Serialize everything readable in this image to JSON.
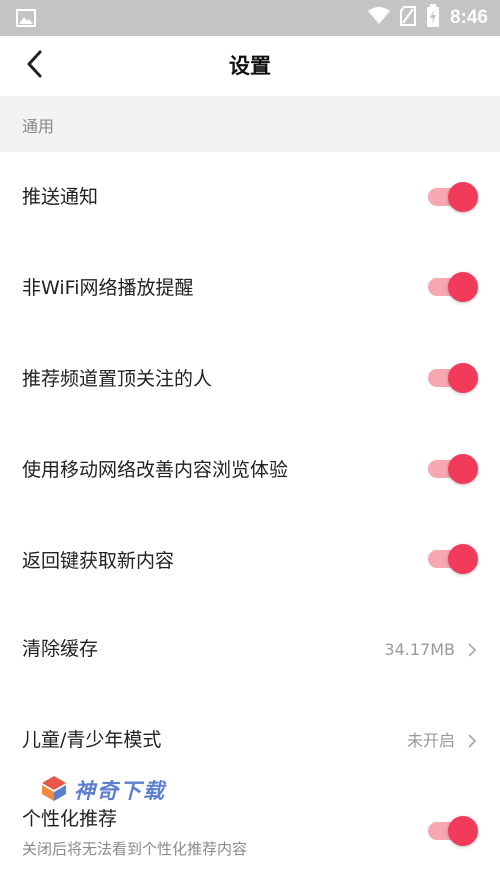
{
  "status_bar": {
    "time": "8:46"
  },
  "header": {
    "title": "设置"
  },
  "section": {
    "label": "通用"
  },
  "rows": [
    {
      "label": "推送通知",
      "toggle_on": true
    },
    {
      "label": "非WiFi网络播放提醒",
      "toggle_on": true
    },
    {
      "label": "推荐频道置顶关注的人",
      "toggle_on": true
    },
    {
      "label": "使用移动网络改善内容浏览体验",
      "toggle_on": true
    },
    {
      "label": "返回键获取新内容",
      "toggle_on": true
    }
  ],
  "cache": {
    "label": "清除缓存",
    "value": "34.17MB"
  },
  "kids_mode": {
    "label": "儿童/青少年模式",
    "value": "未开启"
  },
  "personalized": {
    "label": "个性化推荐",
    "sublabel": "关闭后将无法看到个性化推荐内容",
    "toggle_on": true
  },
  "watermark": {
    "text": "神奇下载"
  },
  "colors": {
    "accent": "#f23b5b",
    "track": "#f6a7b0",
    "status_bar": "#c4c4c4",
    "section_bg": "#f2f2f2"
  },
  "icons": [
    "image-icon",
    "wifi-icon",
    "sim-icon",
    "battery-icon",
    "back-arrow-icon",
    "chevron-right-icon",
    "logo-icon"
  ]
}
